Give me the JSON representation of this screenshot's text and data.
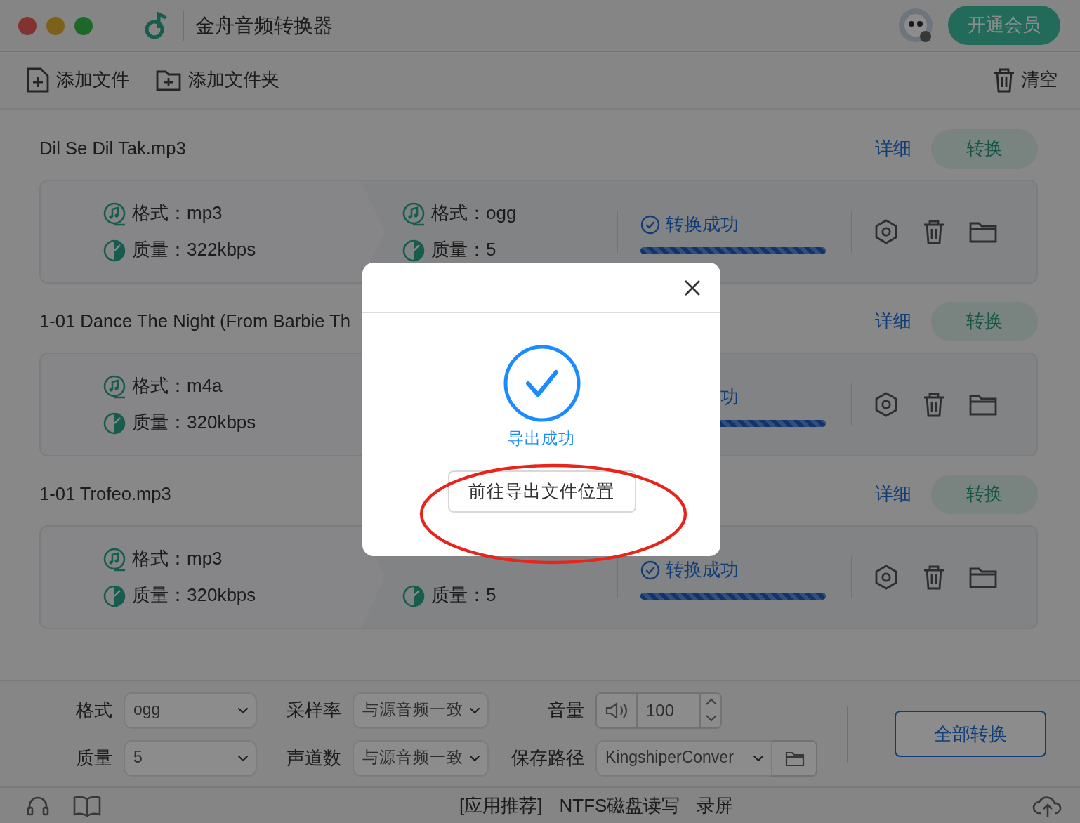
{
  "window": {
    "title": "金舟音频转换器"
  },
  "header": {
    "vip_button": "开通会员"
  },
  "toolbar": {
    "add_file": "添加文件",
    "add_folder": "添加文件夹",
    "clear": "清空"
  },
  "files": [
    {
      "name": "Dil Se Dil Tak.mp3",
      "detail_link": "详细",
      "convert_button": "转换",
      "source": {
        "format": "格式：mp3",
        "quality": "质量：322kbps"
      },
      "target": {
        "format": "格式：ogg",
        "quality": "质量：5"
      },
      "status": {
        "text": "转换成功",
        "icon": true
      },
      "level": 1
    },
    {
      "name": "1-01 Dance The Night (From Barbie Th",
      "detail_link": "详细",
      "convert_button": "转换",
      "source": {
        "format": "格式：m4a",
        "quality": "质量：320kbps"
      },
      "status": {
        "text": "功",
        "icon": false
      },
      "level": 1
    },
    {
      "name": "1-01 Trofeo.mp3",
      "detail_link": "详细",
      "convert_button": "转换",
      "source": {
        "format": "格式：mp3",
        "quality": "质量：320kbps"
      },
      "target": {
        "quality": "质量：5"
      },
      "status": {
        "text": "转换成功",
        "icon": true
      },
      "level": 1
    }
  ],
  "settings": {
    "format": {
      "label": "格式",
      "value": "ogg"
    },
    "sample_rate": {
      "label": "采样率",
      "value": "与源音频一致"
    },
    "volume": {
      "label": "音量",
      "value": "100"
    },
    "quality": {
      "label": "质量",
      "value": "5"
    },
    "channels": {
      "label": "声道数",
      "value": "与源音频一致"
    },
    "save_path": {
      "label": "保存路径",
      "value": "KingshiperConver"
    },
    "convert_all": "全部转换"
  },
  "status_bar": {
    "links": [
      "[应用推荐]",
      "NTFS磁盘读写",
      "录屏"
    ]
  },
  "dialog": {
    "message": "导出成功",
    "button": "前往导出文件位置"
  }
}
